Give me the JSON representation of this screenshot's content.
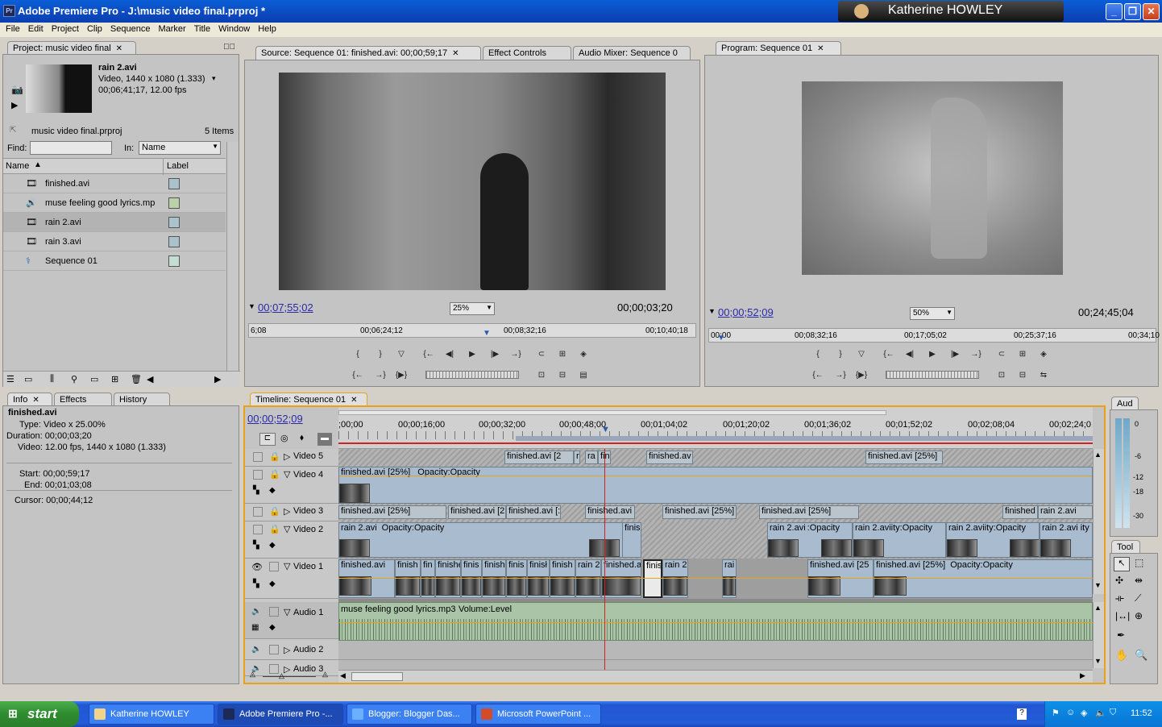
{
  "window": {
    "title": "Adobe Premiere Pro - J:\\music video final.prproj *",
    "app_icon": "Pr",
    "user": "Katherine HOWLEY"
  },
  "menu": [
    "File",
    "Edit",
    "Project",
    "Clip",
    "Sequence",
    "Marker",
    "Title",
    "Window",
    "Help"
  ],
  "project": {
    "tab": "Project: music video final",
    "clip_name": "rain 2.avi",
    "clip_info1": "Video, 1440 x 1080 (1.333)",
    "clip_info2": "00;06;41;17, 12.00 fps",
    "project_file": "music video final.prproj",
    "item_count": "5 Items",
    "find_label": "Find:",
    "in_label": "In:",
    "in_value": "Name",
    "col_name": "Name",
    "col_label": "Label",
    "items": [
      {
        "name": "finished.avi",
        "icon": "film-icon",
        "color": "#a9c3cc"
      },
      {
        "name": "muse feeling good lyrics.mp",
        "icon": "audio-icon",
        "color": "#b9d0a9"
      },
      {
        "name": "rain 2.avi",
        "icon": "film-icon",
        "color": "#a9c3cc"
      },
      {
        "name": "rain 3.avi",
        "icon": "film-icon",
        "color": "#a9c3cc"
      },
      {
        "name": "Sequence 01",
        "icon": "sequence-icon",
        "color": "#c6ddd4"
      }
    ]
  },
  "source": {
    "tab": "Source: Sequence 01: finished.avi: 00;00;59;17",
    "tab2": "Effect Controls",
    "tab3": "Audio Mixer: Sequence 0",
    "timecode": "00;07;55;02",
    "zoom": "25%",
    "duration": "00;00;03;20",
    "ruler": [
      "6;08",
      "00;06;24;12",
      "00;08;32;16",
      "00;10;40;18"
    ]
  },
  "program": {
    "tab": "Program: Sequence 01",
    "timecode": "00;00;52;09",
    "zoom": "50%",
    "duration": "00;24;45;04",
    "ruler": [
      "00;00",
      "00;08;32;16",
      "00;17;05;02",
      "00;25;37;16",
      "00;34;10"
    ]
  },
  "info": {
    "tabs": [
      "Info",
      "Effects",
      "History"
    ],
    "name": "finished.avi",
    "type": "Type:  Video x 25.00%",
    "duration": "Duration:  00;00;03;20",
    "video": "Video:  12.00 fps, 1440 x 1080 (1.333)",
    "start": "Start:  00;00;59;17",
    "end": "End:  00;01;03;08",
    "cursor": "Cursor:  00;00;44;12"
  },
  "timeline": {
    "tab": "Timeline: Sequence 01",
    "timecode": "00;00;52;09",
    "ruler": [
      ";00;00",
      "00;00;16;00",
      "00;00;32;00",
      "00;00;48;00",
      "00;01;04;02",
      "00;01;20;02",
      "00;01;36;02",
      "00;01;52;02",
      "00;02;08;04",
      "00;02;24;0"
    ],
    "tracks": {
      "v5": "Video 5",
      "v4": "Video 4",
      "v3": "Video 3",
      "v2": "Video 2",
      "v1": "Video 1",
      "a1": "Audio 1",
      "a2": "Audio 2",
      "a3": "Audio 3"
    },
    "v5_clips": [
      "finished.avi [2",
      "r",
      "ra",
      "fin",
      "finished.av",
      "finished.avi [25%]"
    ],
    "v4_clip": "finished.avi [25%]",
    "v4_effect": "Opacity:Opacity",
    "v3_clips": [
      "finished.avi [25%]",
      "finished.avi [2",
      "finished.avi [:",
      "finished.avi [",
      "finished.avi [25%]",
      "finished.avi [25%]",
      "finished",
      "rain 2.avi"
    ],
    "v2_clips": [
      "rain 2.avi",
      "Opacity:Opacity",
      "finis",
      "rain 2.avi",
      ":Opacity",
      "rain 2.avi",
      "ity:Opacity",
      "rain 2.avi",
      "ity:Opacity",
      "rain 2.avi",
      "ity"
    ],
    "v1_clips": [
      "finished.avi",
      "finish",
      "fin",
      "finishe",
      "finis",
      "finish",
      "finis",
      "finisł",
      "finish",
      "rain 2",
      "finished.a",
      "finis",
      "rain 2",
      "rai",
      "finished.avi [25",
      "finished.avi [25%]",
      "Opacity:Opacity"
    ],
    "a1_clip": "muse feeling good lyrics.mp3",
    "a1_effect": "Volume:Level"
  },
  "audio_meter": {
    "tab": "Aud",
    "labels": [
      "0",
      "-6",
      "-12",
      "-18",
      "-30"
    ]
  },
  "tools": {
    "tab": "Tool"
  },
  "taskbar": {
    "start": "start",
    "tasks": [
      "Katherine HOWLEY",
      "Adobe Premiere Pro -...",
      "Blogger: Blogger Das...",
      "Microsoft PowerPoint ..."
    ],
    "clock": "11:52"
  },
  "colors": {
    "accent_orange": "#e8a21a",
    "playhead": "#cc2222",
    "timecode_blue": "#2a2aa8"
  }
}
